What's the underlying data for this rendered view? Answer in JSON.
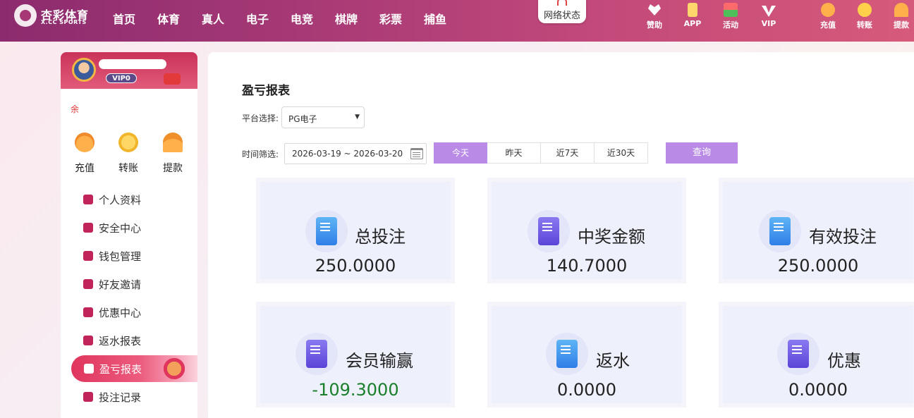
{
  "header": {
    "logo_title": "杏彩体育",
    "logo_sub": "X.CC SPORTS",
    "nav": [
      "首页",
      "体育",
      "真人",
      "电子",
      "电竞",
      "棋牌",
      "彩票",
      "捕鱼"
    ],
    "network_status": "网络状态",
    "quick_links": [
      {
        "label": "赞助",
        "icon": "heart-hands-icon"
      },
      {
        "label": "APP",
        "icon": "phone-icon"
      },
      {
        "label": "活动",
        "icon": "gift-icon"
      },
      {
        "label": "VIP",
        "icon": "vip-icon"
      },
      {
        "label": "充值",
        "icon": "money-bag-icon"
      },
      {
        "label": "转账",
        "icon": "coins-icon"
      },
      {
        "label": "提款",
        "icon": "fan-icon"
      }
    ]
  },
  "sidebar": {
    "username": "",
    "vip_level": "VIP0",
    "balance_label": "余",
    "quick": [
      {
        "label": "充值",
        "icon": "money-bag-icon"
      },
      {
        "label": "转账",
        "icon": "coins-icon"
      },
      {
        "label": "提款",
        "icon": "fan-icon"
      }
    ],
    "menu": [
      {
        "label": "个人资料",
        "icon": "id-card-icon"
      },
      {
        "label": "安全中心",
        "icon": "shield-icon"
      },
      {
        "label": "钱包管理",
        "icon": "wallet-icon"
      },
      {
        "label": "好友邀请",
        "icon": "invite-icon"
      },
      {
        "label": "优惠中心",
        "icon": "ticket-icon"
      },
      {
        "label": "返水报表",
        "icon": "refund-report-icon"
      },
      {
        "label": "盈亏报表",
        "icon": "profit-report-icon"
      },
      {
        "label": "投注记录",
        "icon": "bet-record-icon"
      }
    ],
    "active_index": 6
  },
  "main": {
    "title": "盈亏报表",
    "platform_label": "平台选择:",
    "platform_value": "PG电子",
    "time_label": "时间筛选:",
    "date_range": "2026-03-19 ~ 2026-03-20",
    "periods": [
      "今天",
      "昨天",
      "近7天",
      "近30天"
    ],
    "active_period": 0,
    "query_label": "查询",
    "cards": [
      {
        "title": "总投注",
        "value": "250.0000",
        "icon": "document-icon"
      },
      {
        "title": "中奖金额",
        "value": "140.7000",
        "icon": "trophy-receipt-icon"
      },
      {
        "title": "有效投注",
        "value": "250.0000",
        "icon": "ticket-icon"
      },
      {
        "title": "会员输赢",
        "value": "-109.3000",
        "icon": "robot-icon",
        "value_color": "#1a7f2a"
      },
      {
        "title": "返水",
        "value": "0.0000",
        "icon": "document-icon"
      },
      {
        "title": "优惠",
        "value": "0.0000",
        "icon": "hand-coin-icon"
      }
    ]
  },
  "colors": {
    "header_start": "#8c2b6e",
    "header_end": "#d65a7a",
    "accent_purple": "#b98be6",
    "menu_active": "#e0365e",
    "negative_value": "#1a7f2a"
  }
}
